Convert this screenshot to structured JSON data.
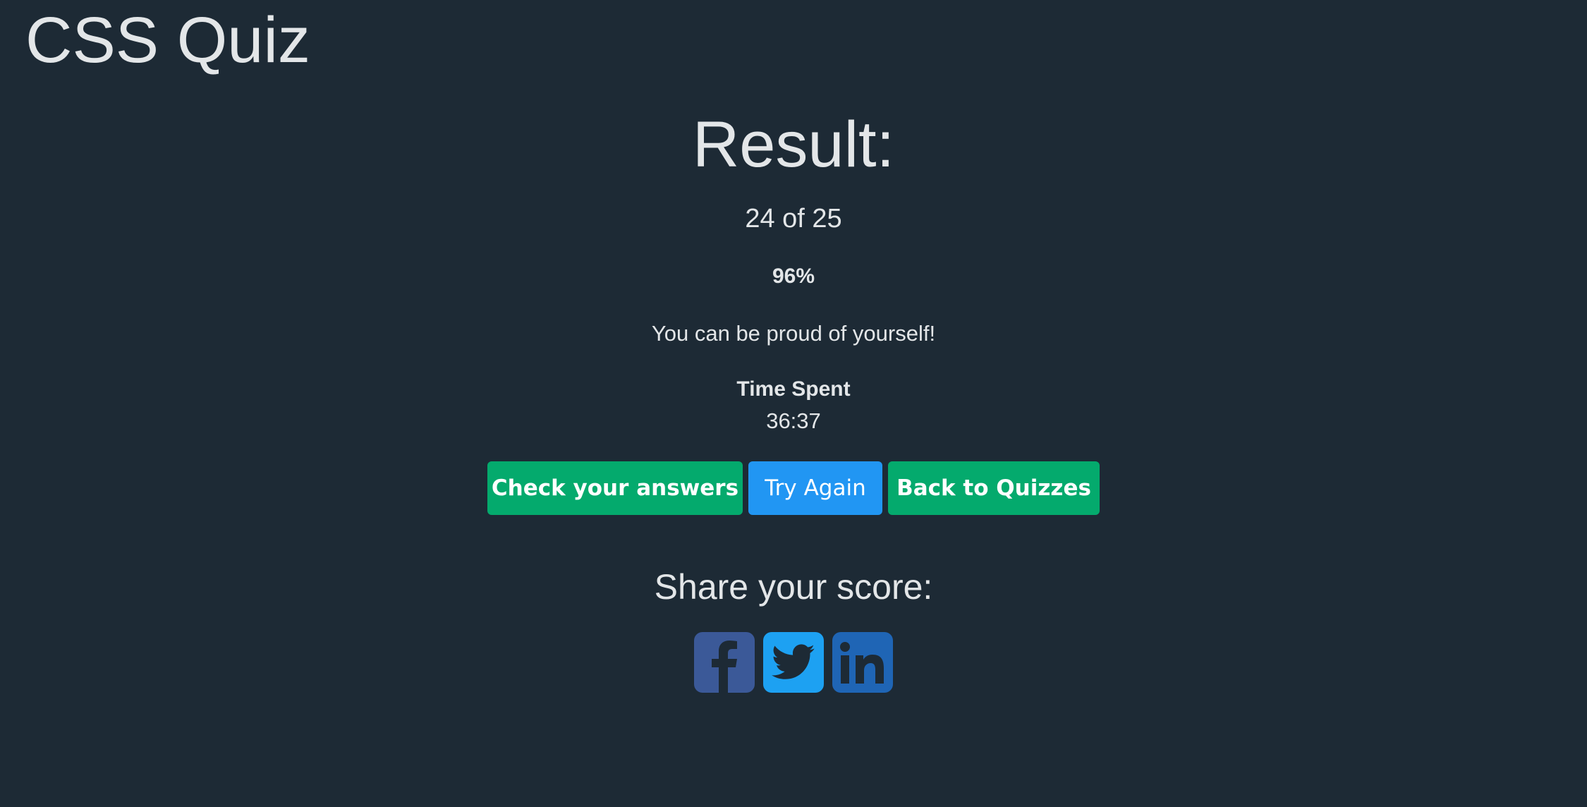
{
  "header": {
    "title": "CSS Quiz"
  },
  "result": {
    "heading": "Result:",
    "score_text": "24 of 25",
    "percentage_text": "96%",
    "message": "You can be proud of yourself!",
    "time_label": "Time Spent",
    "time_value": "36:37"
  },
  "actions": {
    "check_answers_label": "Check your answers",
    "try_again_label": "Try Again",
    "back_label": "Back to Quizzes"
  },
  "share": {
    "heading": "Share your score:",
    "networks": [
      {
        "name": "facebook",
        "icon": "facebook-icon",
        "color": "#3b5998"
      },
      {
        "name": "twitter",
        "icon": "twitter-icon",
        "color": "#1da1f2"
      },
      {
        "name": "linkedin",
        "icon": "linkedin-icon",
        "color": "#1f65b5"
      }
    ]
  },
  "colors": {
    "background": "#1d2a35",
    "text": "#e3e6e8",
    "green_button": "#04aa6d",
    "blue_button": "#2196f3"
  }
}
